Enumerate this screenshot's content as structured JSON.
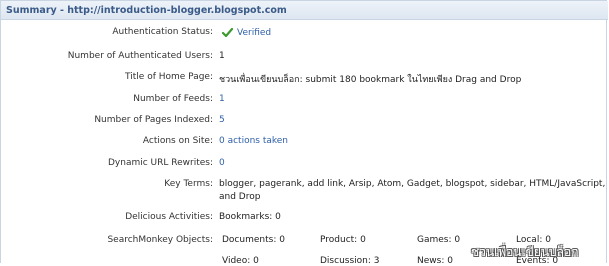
{
  "header": {
    "title": "Summary - http://introduction-blogger.blogspot.com"
  },
  "rows": [
    {
      "label": "Authentication Status:",
      "value": "Verified"
    },
    {
      "label": "Number of Authenticated Users:",
      "value": "1"
    },
    {
      "label": "Title of Home Page:",
      "value": "ชวนเพื่อนเขียนบล็อก: submit 180 bookmark ในไทยเพียง Drag and Drop"
    },
    {
      "label": "Number of Feeds:",
      "value": "1"
    },
    {
      "label": "Number of Pages Indexed:",
      "value": "5"
    },
    {
      "label": "Actions on Site:",
      "value": "0 actions taken"
    },
    {
      "label": "Dynamic URL Rewrites:",
      "value": "0"
    },
    {
      "label": "Key Terms:",
      "value_line1": "blogger, pagerank, add link, Arsip, Atom, Gadget, blogspot, sidebar, HTML/JavaScript, Drag",
      "value_line2": "and Drop"
    },
    {
      "label": "Delicious Activities:",
      "value": "Bookmarks: 0"
    },
    {
      "label": "SearchMonkey Objects:"
    }
  ],
  "searchmonkey": {
    "documents": "Documents: 0",
    "product": "Product: 0",
    "games": "Games: 0",
    "local": "Local: 0",
    "video": "Video: 0",
    "discussion": "Discussion: 3",
    "news": "News: 0",
    "events": "Events: 0"
  },
  "watermark": "ชวนเพื่อนเขียนบล็อก",
  "colors": {
    "link": "#2e5fa8",
    "header_text": "#3a5a88",
    "verified_check": "#3c9a2e"
  }
}
